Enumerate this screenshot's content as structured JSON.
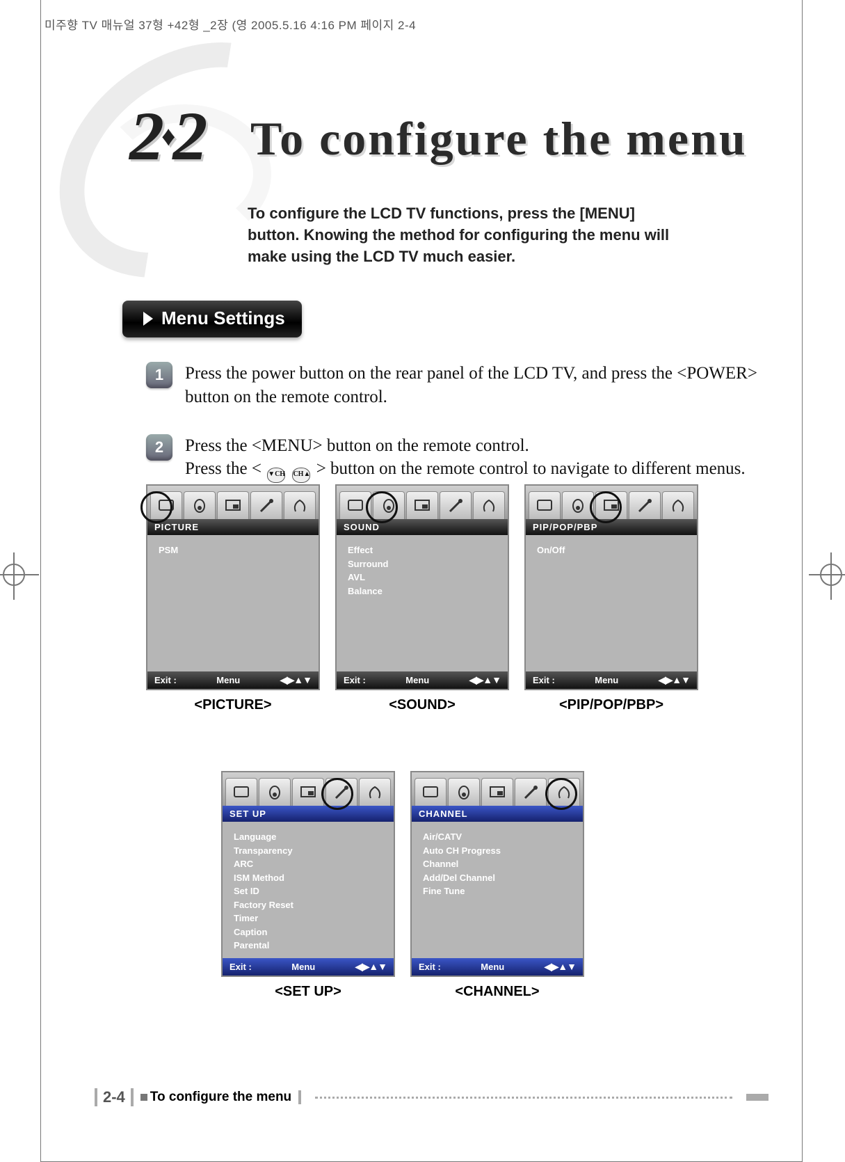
{
  "slug": "미주향 TV 매뉴얼 37형 +42형 _2장 (영   2005.5.16 4:16 PM  페이지 2-4",
  "section_number_parts": {
    "a": "2",
    "dot": "♦",
    "b": "2"
  },
  "title": "To configure the menu",
  "intro": "To configure the LCD TV functions, press the [MENU] button. Knowing the method for configuring the menu will make using the LCD TV much easier.",
  "section_badge": "Menu Settings",
  "steps": {
    "s1": "Press the power button on the rear panel of the LCD TV, and press the <POWER> button on the remote control.",
    "s2a": "Press the <MENU> button on the remote control.",
    "s2b_pre": "Press the < ",
    "s2b_btn1": "▼CH",
    "s2b_btn2": "CH▲",
    "s2b_post": " > button on the remote control to navigate to different menus."
  },
  "step_numbers": {
    "n1": "1",
    "n2": "2"
  },
  "menu_footer": {
    "exit": "Exit :",
    "menu": "Menu",
    "arrows": "◀▶▲▼"
  },
  "menus": {
    "picture": {
      "header": "PICTURE",
      "items": [
        "PSM"
      ],
      "caption": "<PICTURE>"
    },
    "sound": {
      "header": "SOUND",
      "items": [
        "Effect",
        "Surround",
        "AVL",
        "Balance"
      ],
      "caption": "<SOUND>"
    },
    "pip": {
      "header": "PIP/POP/PBP",
      "items": [
        "On/Off"
      ],
      "caption": "<PIP/POP/PBP>"
    },
    "setup": {
      "header": "SET UP",
      "items": [
        "Language",
        "Transparency",
        "ARC",
        "ISM Method",
        "Set ID",
        "Factory Reset",
        "Timer",
        "Caption",
        "Parental"
      ],
      "caption": "<SET UP>"
    },
    "channel": {
      "header": "CHANNEL",
      "items": [
        "Air/CATV",
        "Auto CH Progress",
        "Channel",
        "Add/Del Channel",
        "Fine Tune"
      ],
      "caption": "<CHANNEL>"
    }
  },
  "footer": {
    "page": "2-4",
    "section": "To configure the menu"
  }
}
